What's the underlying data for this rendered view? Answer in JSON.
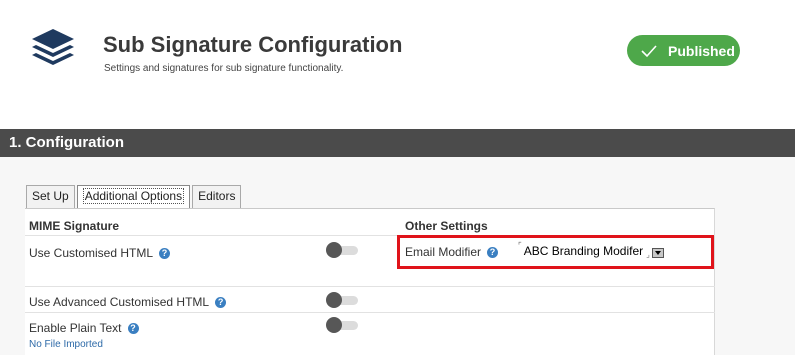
{
  "header": {
    "title": "Sub Signature Configuration",
    "subtitle": "Settings and signatures for sub signature functionality.",
    "status": "Published",
    "logo_icon": "stacked-layers-icon",
    "status_color": "#4ea84a"
  },
  "section": {
    "title": "1. Configuration"
  },
  "tabs": [
    {
      "label": "Set Up",
      "active": false
    },
    {
      "label": "Additional Options",
      "active": true
    },
    {
      "label": "Editors",
      "active": false
    }
  ],
  "columns": {
    "left_header": "MIME Signature",
    "right_header": "Other Settings"
  },
  "settings": {
    "use_customised_html": {
      "label": "Use Customised HTML",
      "enabled": false
    },
    "use_advanced_customised_html": {
      "label": "Use Advanced Customised HTML",
      "enabled": false
    },
    "enable_plain_text": {
      "label": "Enable Plain Text",
      "enabled": false,
      "note": "No File Imported"
    }
  },
  "email_modifier": {
    "label": "Email Modifier",
    "value": "ABC Branding Modifer",
    "highlight_color": "#e0131a"
  },
  "icons": {
    "help": "help-circle-icon",
    "check": "check-icon",
    "dropdown": "chevron-down-icon"
  }
}
